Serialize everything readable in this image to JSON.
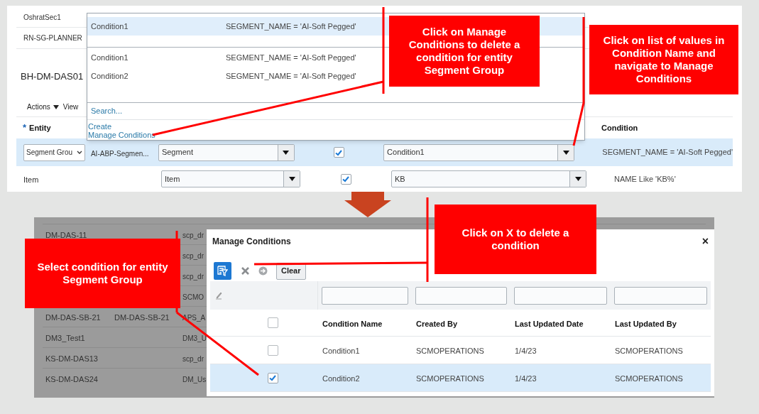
{
  "top_screen": {
    "background_rows": [
      "OshratSec1",
      "RN-SG-PLANNER"
    ],
    "title": "BH-DM-DAS01",
    "toolbar": {
      "actions": "Actions",
      "view": "View"
    },
    "required_mark": "*",
    "columns": [
      "Entity",
      "Condition"
    ],
    "rows": [
      {
        "selected": true,
        "kind": "select",
        "entity": "Segment Grou",
        "name": "AI-ABP-Segmen...",
        "type": "Segment",
        "enabled": true,
        "condition_name": "Condition1",
        "condition": "SEGMENT_NAME = 'AI-Soft Pegged'"
      },
      {
        "selected": false,
        "kind": "text",
        "entity": "Item",
        "type": "Item",
        "enabled": true,
        "condition_name": "KB",
        "condition": "NAME Like 'KB%'"
      }
    ],
    "dropdown": {
      "current": {
        "name": "Condition1",
        "condition": "SEGMENT_NAME = 'AI-Soft Pegged'"
      },
      "options": [
        {
          "name": "Condition1",
          "condition": "SEGMENT_NAME = 'AI-Soft Pegged'",
          "selected": false
        },
        {
          "name": "Condition2",
          "condition": "SEGMENT_NAME = 'AI-Soft Pegged'",
          "selected": false
        }
      ],
      "search": "Search...",
      "links": [
        "Create",
        "Manage Conditions"
      ]
    }
  },
  "bottom_screen": {
    "background_rows": [
      {
        "column_1": "DM-DAS-11",
        "column_3": "scp_dr"
      },
      {
        "column_3": "scp_dr"
      },
      {
        "column_3": "scp_dr"
      },
      {
        "column_3": "SCMO"
      },
      {
        "column_1": "DM-DAS-SB-21",
        "column_2": "DM-DAS-SB-21",
        "column_3": "APS_A"
      },
      {
        "column_1": "DM3_Test1",
        "column_3": "DM3_U"
      },
      {
        "column_1": "KS-DM-DAS13",
        "column_3": "scp_dr"
      },
      {
        "column_1": "KS-DM-DAS24",
        "column_3": "DM_Us"
      }
    ],
    "dialog": {
      "title": "Manage Conditions",
      "close": "×",
      "toolbar": [
        {
          "kind": "query"
        },
        {
          "kind": "delete"
        },
        {
          "kind": "go"
        },
        {
          "kind": "text",
          "label": "Clear"
        }
      ],
      "header_checked": false,
      "columns": [
        "Condition Name",
        "Created By",
        "Last Updated Date",
        "Last Updated By"
      ],
      "rows": [
        {
          "checked": false,
          "selected": false,
          "cells": [
            "Condition1",
            "SCMOPERATIONS",
            "1/4/23",
            "SCMOPERATIONS"
          ]
        },
        {
          "checked": true,
          "selected": true,
          "cells": [
            "Condition2",
            "SCMOPERATIONS",
            "1/4/23",
            "SCMOPERATIONS"
          ]
        }
      ]
    }
  },
  "callouts": [
    "Click on Manage Conditions to delete a condition for entity Segment Group",
    "Click on list of values in Condition Name and navigate to Manage Conditions",
    "Click on X to delete a condition",
    "Select condition for entity Segment Group"
  ]
}
